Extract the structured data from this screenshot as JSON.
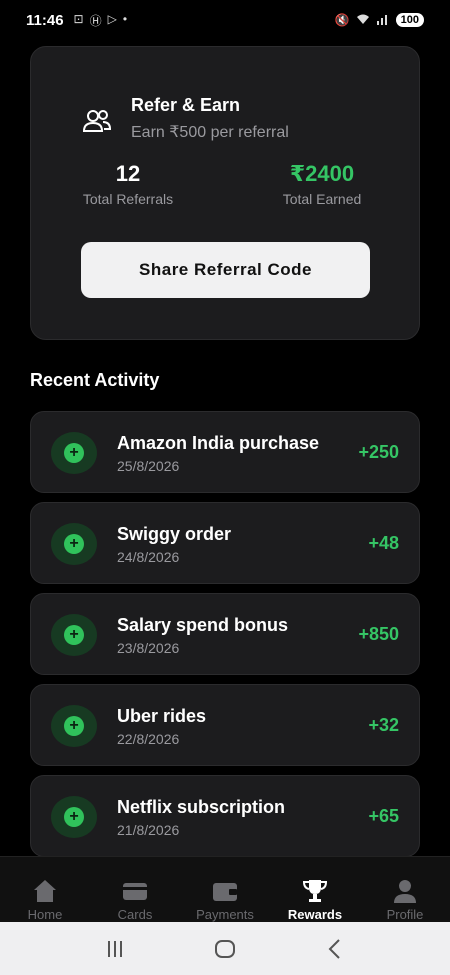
{
  "status_bar": {
    "time": "11:46",
    "battery": "100",
    "icons_left": [
      "screen-record-icon",
      "h-icon",
      "play-icon",
      "dot-icon"
    ],
    "icons_right": [
      "mute-icon",
      "wifi-icon",
      "signal-icon"
    ]
  },
  "referral": {
    "title": "Refer & Earn",
    "subtitle": "Earn ₹500 per referral",
    "icon": "users-icon",
    "total_referrals_value": "12",
    "total_referrals_label": "Total Referrals",
    "total_earned_value": "₹2400",
    "total_earned_label": "Total Earned",
    "share_button": "Share Referral Code"
  },
  "recent_activity": {
    "title": "Recent Activity",
    "items": [
      {
        "title": "Amazon India purchase",
        "date": "25/8/2026",
        "amount": "+250"
      },
      {
        "title": "Swiggy order",
        "date": "24/8/2026",
        "amount": "+48"
      },
      {
        "title": "Salary spend bonus",
        "date": "23/8/2026",
        "amount": "+850"
      },
      {
        "title": "Uber rides",
        "date": "22/8/2026",
        "amount": "+32"
      },
      {
        "title": "Netflix subscription",
        "date": "21/8/2026",
        "amount": "+65"
      }
    ]
  },
  "nav": {
    "items": [
      {
        "label": "Home",
        "icon": "home-icon"
      },
      {
        "label": "Cards",
        "icon": "card-icon"
      },
      {
        "label": "Payments",
        "icon": "wallet-icon"
      },
      {
        "label": "Rewards",
        "icon": "trophy-icon",
        "active": true
      },
      {
        "label": "Profile",
        "icon": "person-icon"
      }
    ]
  },
  "colors": {
    "accent_green": "#35c565",
    "card_bg": "#1c1c1e",
    "background": "#000000"
  }
}
